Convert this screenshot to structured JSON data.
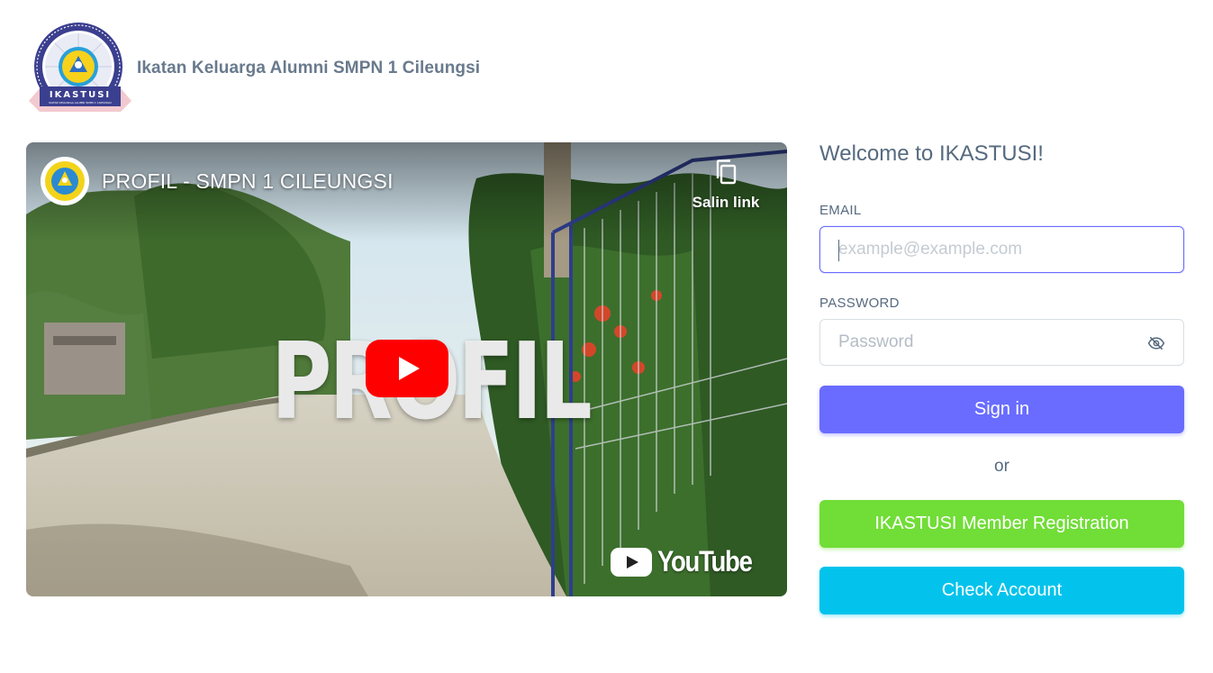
{
  "header": {
    "logo_text": "IKASTUSI",
    "logo_subtext": "IKATAN KELUARGA ALUMNI SMPN 1 CILEUNGSI",
    "brand_name": "Ikatan Keluarga Alumni SMPN 1 Cileungsi"
  },
  "video": {
    "title": "PROFIL - SMPN 1 CILEUNGSI",
    "copy_link_label": "Salin link",
    "overlay_word": "PROFIL",
    "platform_label": "YouTube",
    "icons": {
      "channel": "school-emblem-icon",
      "copy": "copy-icon",
      "play": "play-icon"
    }
  },
  "login": {
    "welcome": "Welcome to IKASTUSI!",
    "email_label": "EMAIL",
    "email_placeholder": "example@example.com",
    "email_value": "",
    "password_label": "PASSWORD",
    "password_placeholder": "Password",
    "password_value": "",
    "password_toggle_icon": "eye-off-icon",
    "signin_label": "Sign in",
    "or_label": "or",
    "register_label": "IKASTUSI Member Registration",
    "check_label": "Check Account"
  },
  "colors": {
    "primary": "#696cff",
    "success": "#71dd37",
    "info": "#03c3ec",
    "text": "#566a7f"
  }
}
